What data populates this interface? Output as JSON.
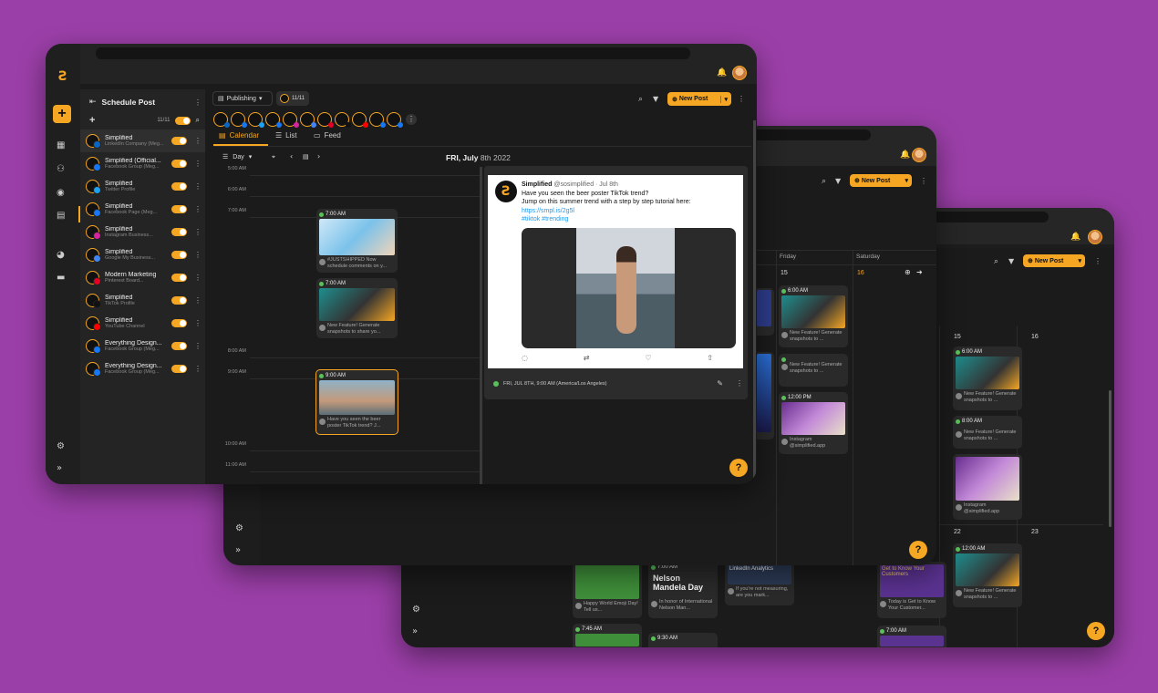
{
  "app": {
    "title": "Schedule Post",
    "count": "11/11",
    "publishing": "Publishing",
    "select_count": "11/11",
    "new_post": "New Post",
    "help": "?"
  },
  "tabs": [
    "Calendar",
    "List",
    "Feed"
  ],
  "view": {
    "mode": "Day",
    "date_title": "FRI, July",
    "date_rest": "8th 2022"
  },
  "accounts": [
    {
      "name": "Simplified",
      "type": "LinkedIn Company (Meg...",
      "badge": "#0a66c2"
    },
    {
      "name": "Simplified (Official...",
      "type": "Facebook Group (Meg...",
      "badge": "#1877f2"
    },
    {
      "name": "Simplified",
      "type": "Twitter Profile",
      "badge": "#1da1f2"
    },
    {
      "name": "Simplified",
      "type": "Facebook Page (Meg...",
      "badge": "#1877f2"
    },
    {
      "name": "Simplified",
      "type": "Instagram Business...",
      "badge": "#d6249f"
    },
    {
      "name": "Simplified",
      "type": "Google My Business...",
      "badge": "#4285f4"
    },
    {
      "name": "Modern Marketing",
      "type": "Pinterest Board...",
      "badge": "#e60023"
    },
    {
      "name": "Simplified",
      "type": "TikTok Profile",
      "badge": "#111111"
    },
    {
      "name": "Simplified",
      "type": "YouTube Channel",
      "badge": "#ff0000"
    },
    {
      "name": "Everything Design...",
      "type": "Facebook Group (Meg...",
      "badge": "#1877f2"
    },
    {
      "name": "Everything Design...",
      "type": "Facebook Group (Meg...",
      "badge": "#1877f2"
    }
  ],
  "times": [
    "5:00 AM",
    "6:00 AM",
    "7:00 AM",
    "8:00 AM",
    "9:00 AM",
    "10:00 AM",
    "11:00 AM"
  ],
  "day_posts": [
    {
      "time": "7:00 AM",
      "caption": "#JUSTSHIPPED Now schedule comments on y..."
    },
    {
      "time": "7:00 AM",
      "caption": "New Feature! Generate snapshots to share yo..."
    },
    {
      "time": "9:00 AM",
      "caption": "Have you seen the beer poster TikTok trend? J..."
    }
  ],
  "tweet": {
    "name": "Simplified",
    "handle": "@sosimplified · Jul 8th",
    "line1": "Have you seen the beer poster TikTok trend?",
    "line2": "Jump on this summer trend with a step by step tutorial here:",
    "link": "https://smpl.is/2g5l",
    "tags": "#tiktok #trending",
    "footer": "FRI, JUL 8TH, 9:00 AM (America/Los Angeles)"
  },
  "week": {
    "friday": "Friday",
    "saturday": "Saturday",
    "d15": "15",
    "d16": "16"
  },
  "week_posts": [
    {
      "time": "6:00 AM",
      "caption": "New Feature! Generate snapshots to ..."
    },
    {
      "time": "",
      "caption": "New Feature! Generate snapshots to ..."
    },
    {
      "time": "12:00 PM",
      "caption": "Instagram @simplified.app Pinterest..."
    }
  ],
  "month": {
    "d15": "15",
    "d16": "16",
    "d22": "22",
    "d23": "23"
  },
  "month_posts": [
    {
      "time": "6:00 AM",
      "caption": "New Feature! Generate snapshots to ..."
    },
    {
      "time": "8:00 AM",
      "caption": "New Feature! Generate snapshots to ..."
    },
    {
      "time": "",
      "caption": "Instagram @simplified.app Pinterest..."
    },
    {
      "time": "12:00 AM",
      "caption": "New Feature! Generate snapshots to ..."
    }
  ],
  "bottom_posts": [
    {
      "time": "",
      "caption": "Happy World Emoji Day! Tell us..."
    },
    {
      "time": "7:00 AM",
      "caption": "In honor of International Nelson Man..."
    },
    {
      "time": "",
      "caption": "If you're not measuring, are you mark..."
    },
    {
      "time": "",
      "caption": "Today is Get to Know Your Customer..."
    },
    {
      "time": "7:45 AM",
      "caption": ""
    },
    {
      "time": "9:30 AM",
      "caption": ""
    },
    {
      "time": "7:00 AM",
      "caption": ""
    }
  ],
  "bottom_texts": {
    "nelson": "Nelson Mandela Day",
    "linkedin": "LinkedIn Analytics",
    "gtk": "Get to Know Your Customers"
  }
}
